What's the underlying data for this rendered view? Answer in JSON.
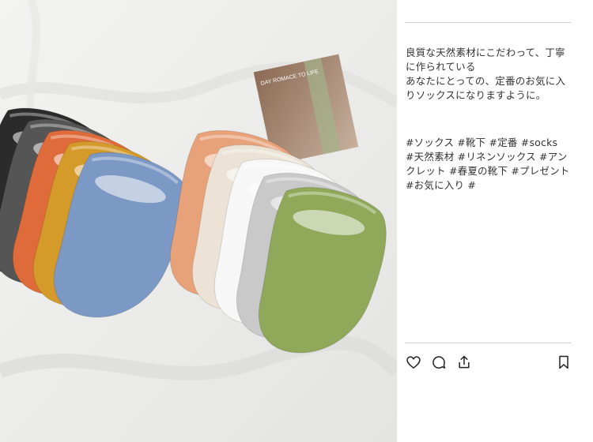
{
  "photo": {
    "alt_icon": "product-photo",
    "postcard_text": "DAY ROMACE TO LIFE",
    "colors": {
      "background": "#eeeeec",
      "black": "#2b2b2b",
      "charcoal": "#555555",
      "orange": "#e06b3a",
      "mustard": "#d49a2a",
      "denim": "#7c98c4",
      "peach": "#e8a27a",
      "cream": "#ece3d6",
      "white": "#f7f7f7",
      "gray": "#c9c9c9",
      "olive": "#8fa85a"
    }
  },
  "post": {
    "caption": "良質な天然素材にこだわって、丁寧に作られている\nあなたにとっての、定番のお気に入りソックスになりますように。",
    "hashtags": "#ソックス #靴下 #定番 #socks\n#天然素材 #リネンソックス #アンクレット #春夏の靴下 #プレゼント\n#お気に入り #"
  },
  "actions": {
    "like_icon": "heart-icon",
    "comment_icon": "comment-icon",
    "share_icon": "share-icon",
    "save_icon": "bookmark-icon"
  }
}
